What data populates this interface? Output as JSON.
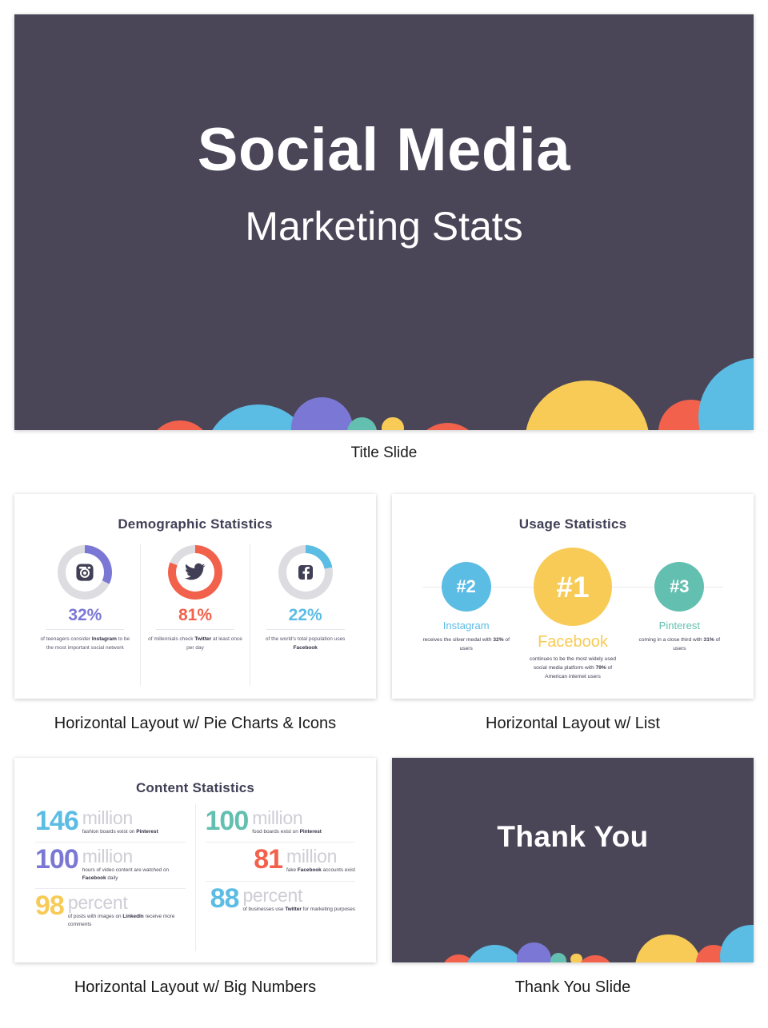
{
  "palette": {
    "dark_bg": "#4a4658",
    "blue": "#5bbce4",
    "red": "#f2614b",
    "yellow": "#f7cb56",
    "purple": "#7b77d4",
    "teal": "#63bfb0",
    "heading": "#413f55",
    "grey_track": "#dcdce1",
    "instagram_purple": "#7b77d4",
    "twitter_red": "#f2614b",
    "facebook_blue": "#5bbce4"
  },
  "title_slide": {
    "title": "Social Media",
    "subtitle": "Marketing Stats",
    "caption": "Title Slide"
  },
  "demographic_slide": {
    "heading": "Demographic Statistics",
    "caption": "Horizontal Layout w/ Pie Charts & Icons",
    "items": [
      {
        "icon": "instagram-icon",
        "percent": "32%",
        "value": 32,
        "color": "#7b77d4",
        "desc_pre": "of teenagers consider ",
        "desc_bold": "Instagram",
        "desc_post": " to be the most important social network"
      },
      {
        "icon": "twitter-icon",
        "percent": "81%",
        "value": 81,
        "color": "#f2614b",
        "desc_pre": "of millennials check ",
        "desc_bold": "Twitter",
        "desc_post": " at least once per day"
      },
      {
        "icon": "facebook-icon",
        "percent": "22%",
        "value": 22,
        "color": "#5bbce4",
        "desc_pre": "of the world's total population uses ",
        "desc_bold": "Facebook",
        "desc_post": ""
      }
    ]
  },
  "usage_slide": {
    "heading": "Usage Statistics",
    "caption": "Horizontal Layout w/ List",
    "items": [
      {
        "rank": "#2",
        "name": "Instagram",
        "color": "#5bbce4",
        "size": "small",
        "desc_pre": "receives the silver medal with ",
        "desc_bold": "32%",
        "desc_post": " of users"
      },
      {
        "rank": "#1",
        "name": "Facebook",
        "color": "#f7cb56",
        "size": "big",
        "desc_pre": "continues to be the most widely used social media platform with ",
        "desc_bold": "79%",
        "desc_post": " of American internet users"
      },
      {
        "rank": "#3",
        "name": "Pinterest",
        "color": "#63bfb0",
        "size": "small",
        "desc_pre": "coming in a close third with ",
        "desc_bold": "31%",
        "desc_post": " of users"
      }
    ]
  },
  "content_slide": {
    "heading": "Content Statistics",
    "caption": "Horizontal Layout w/ Big Numbers",
    "left_column": [
      {
        "number": "146",
        "unit": "million",
        "color": "#5bbce4",
        "desc_pre": "fashion boards exist on ",
        "desc_bold": "Pinterest",
        "desc_post": "",
        "align": "left"
      },
      {
        "number": "100",
        "unit": "million",
        "color": "#7b77d4",
        "desc_pre": "hours of video content are watched on ",
        "desc_bold": "Facebook",
        "desc_post": " daily",
        "align": "left"
      },
      {
        "number": "98",
        "unit": "percent",
        "color": "#f7cb56",
        "desc_pre": "of posts with images on ",
        "desc_bold": "LinkedIn",
        "desc_post": " receive more comments",
        "align": "right"
      }
    ],
    "right_column": [
      {
        "number": "100",
        "unit": "million",
        "color": "#63bfb0",
        "desc_pre": "food boards exist on ",
        "desc_bold": "Pinterest",
        "desc_post": "",
        "align": "left"
      },
      {
        "number": "81",
        "unit": "million",
        "color": "#f2614b",
        "desc_pre": "fake ",
        "desc_bold": "Facebook",
        "desc_post": " accounts exist",
        "align": "right"
      },
      {
        "number": "88",
        "unit": "percent",
        "color": "#5bbce4",
        "desc_pre": "of businesses use ",
        "desc_bold": "Twitter",
        "desc_post": " for marketing purposes",
        "align": "right"
      }
    ]
  },
  "thanks_slide": {
    "text": "Thank You",
    "caption": "Thank You Slide"
  },
  "bubbles_title": [
    {
      "x": 7.6,
      "y": 104.5,
      "r": 1.3,
      "color": "#f7cb56"
    },
    {
      "x": 12.2,
      "y": 109.0,
      "r": 2.0,
      "color": "#63bfb0"
    },
    {
      "x": 20.5,
      "y": 112.0,
      "r": 2.5,
      "color": "#7b77d4"
    },
    {
      "x": 22.4,
      "y": 105.4,
      "r": 4.3,
      "color": "#f2614b"
    },
    {
      "x": 33.0,
      "y": 107.0,
      "r": 7.4,
      "color": "#5bbce4"
    },
    {
      "x": 41.6,
      "y": 99.6,
      "r": 4.2,
      "color": "#7b77d4"
    },
    {
      "x": 47.0,
      "y": 100.5,
      "r": 2.0,
      "color": "#63bfb0"
    },
    {
      "x": 51.2,
      "y": 99.5,
      "r": 1.5,
      "color": "#f7cb56"
    },
    {
      "x": 58.6,
      "y": 106.5,
      "r": 4.6,
      "color": "#f2614b"
    },
    {
      "x": 65.0,
      "y": 111.5,
      "r": 4.3,
      "color": "#63bfb0"
    },
    {
      "x": 77.5,
      "y": 103.0,
      "r": 8.4,
      "color": "#f7cb56"
    },
    {
      "x": 91.5,
      "y": 100.5,
      "r": 4.4,
      "color": "#f2614b"
    },
    {
      "x": 100.5,
      "y": 97.0,
      "r": 8.0,
      "color": "#5bbce4"
    }
  ],
  "bubbles_thanks": [
    {
      "x": 4.0,
      "y": 103.5,
      "r": 1.5,
      "color": "#f7cb56"
    },
    {
      "x": 8.3,
      "y": 108.5,
      "r": 2.4,
      "color": "#63bfb0"
    },
    {
      "x": 14.0,
      "y": 111.5,
      "r": 2.8,
      "color": "#7b77d4"
    },
    {
      "x": 18.5,
      "y": 104.5,
      "r": 4.8,
      "color": "#f2614b"
    },
    {
      "x": 28.5,
      "y": 106.0,
      "r": 8.3,
      "color": "#5bbce4"
    },
    {
      "x": 39.3,
      "y": 98.5,
      "r": 4.7,
      "color": "#7b77d4"
    },
    {
      "x": 46.0,
      "y": 99.5,
      "r": 2.3,
      "color": "#63bfb0"
    },
    {
      "x": 51.0,
      "y": 98.5,
      "r": 1.6,
      "color": "#f7cb56"
    },
    {
      "x": 56.2,
      "y": 105.5,
      "r": 5.0,
      "color": "#f2614b"
    },
    {
      "x": 65.0,
      "y": 111.0,
      "r": 5.0,
      "color": "#63bfb0"
    },
    {
      "x": 76.5,
      "y": 102.5,
      "r": 9.2,
      "color": "#f7cb56"
    },
    {
      "x": 89.0,
      "y": 100.0,
      "r": 4.9,
      "color": "#f2614b"
    },
    {
      "x": 99.5,
      "y": 97.0,
      "r": 8.8,
      "color": "#5bbce4"
    }
  ]
}
